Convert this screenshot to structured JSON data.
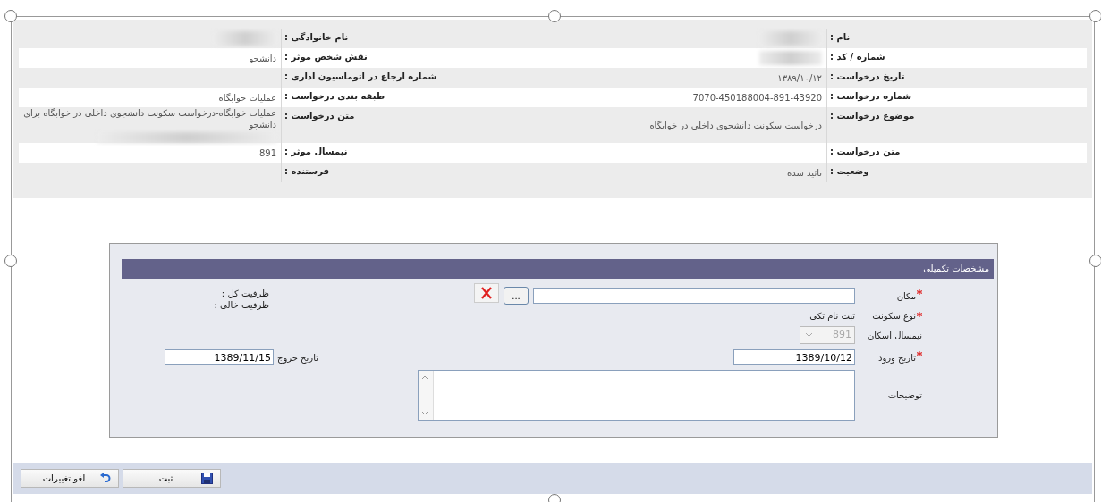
{
  "info_rows": [
    {
      "right": {
        "label": "نام :",
        "redacted": true
      },
      "left": {
        "label": "نام خانوادگی :",
        "redacted": true
      }
    },
    {
      "right": {
        "label": "شماره / کد :",
        "redacted": true
      },
      "left": {
        "label": "نقش شخص موثر :",
        "value": "دانشجو"
      }
    },
    {
      "right": {
        "label": "تاریخ درخواست :",
        "value": "۱۳۸۹/۱۰/۱۲"
      },
      "left": {
        "label": "شماره ارجاع در اتوماسیون اداری :"
      }
    },
    {
      "right": {
        "label": "شماره درخواست :",
        "value": "7070-450188004-891-43920"
      },
      "left": {
        "label": "طبقه بندی درخواست :",
        "value": "عملیات خوابگاه"
      }
    },
    {
      "right": {
        "label": "موضوع درخواست :",
        "value": "درخواست سکونت دانشجوی داخلی در خوابگاه"
      },
      "left": {
        "label": "متن درخواست :",
        "value": "عملیات خوابگاه-درخواست سکونت دانشجوی داخلی در خوابگاه برای دانشجو",
        "redacted": true
      }
    },
    {
      "right": {
        "label": "متن درخواست :"
      },
      "left": {
        "label": "نیمسال موثر :",
        "value": "891"
      }
    },
    {
      "right": {
        "label": "وضعیت :",
        "value": "تائید شده"
      },
      "left": {
        "label": "فرستنده :"
      }
    }
  ],
  "form": {
    "title": "مشخصات تکمیلی",
    "fields": [
      {
        "kind": "text",
        "label": "مکان",
        "required": true,
        "browse_label": "..."
      },
      {
        "kind": "static",
        "label": "نوع سکونت",
        "required": true,
        "value": "ثبت نام تکی"
      },
      {
        "kind": "select",
        "label": "نیمسال اسکان",
        "required": false,
        "value": "891",
        "disabled": true
      },
      {
        "kind": "date",
        "label": "تاریخ ورود",
        "required": true,
        "value": "1389/10/12"
      },
      {
        "kind": "textarea",
        "label": "توضیحات",
        "required": false
      }
    ],
    "capacity_lines": [
      "ظرفیت کل :",
      "ظرفیت خالی :"
    ],
    "exit_date": {
      "label": "تاریخ خروج",
      "value": "1389/11/15"
    }
  },
  "toolbar": {
    "buttons": [
      {
        "kind": "save",
        "label": "ثبت"
      },
      {
        "kind": "undo",
        "label": "لغو تغییرات"
      }
    ]
  }
}
